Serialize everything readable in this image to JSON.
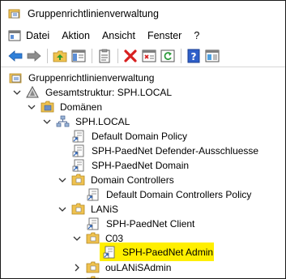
{
  "window": {
    "title": "Gruppenrichtlinienverwaltung"
  },
  "menu": [
    "Datei",
    "Aktion",
    "Ansicht",
    "Fenster",
    "?"
  ],
  "toolbar": {
    "buttons": [
      "back-arrow-icon",
      "forward-arrow-icon",
      "up-folder-icon",
      "show-hide-tree-icon",
      "properties-icon",
      "delete-icon",
      "export-list-icon",
      "refresh-icon",
      "help-icon",
      "view-icon"
    ]
  },
  "tree": {
    "root": "Gruppenrichtlinienverwaltung",
    "forest": "Gesamtstruktur: SPH.LOCAL",
    "domains": "Domänen",
    "domain": "SPH.LOCAL",
    "gpo_default_domain": "Default Domain Policy",
    "gpo_defender": "SPH-PaedNet Defender-Ausschluesse",
    "gpo_domain": "SPH-PaedNet Domain",
    "ou_dc": "Domain Controllers",
    "gpo_default_dc": "Default Domain Controllers Policy",
    "ou_lanis": "LANiS",
    "gpo_client": "SPH-PaedNet Client",
    "ou_c03": "C03",
    "gpo_admin": "SPH-PaedNet Admin",
    "ou_lanisadmin": "ouLANiSAdmin"
  },
  "colors": {
    "selection": "#ffef00",
    "folder": "#e8b84a",
    "link_arrow": "#1e5bb8"
  }
}
